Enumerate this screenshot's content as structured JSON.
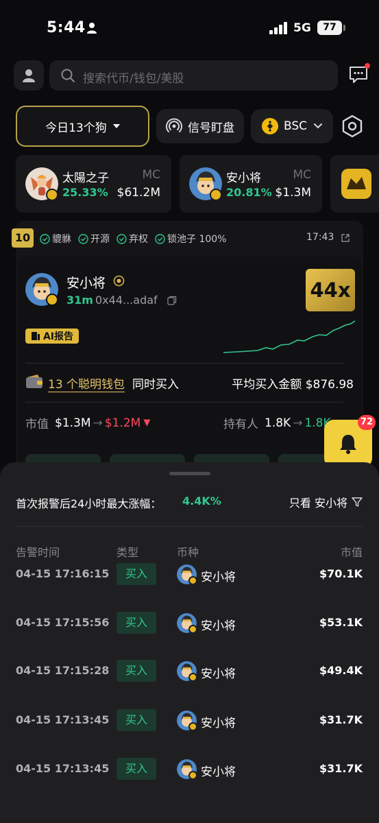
{
  "status": {
    "time": "5:44",
    "network": "5G",
    "battery": "77"
  },
  "search": {
    "placeholder": "搜索代币/钱包/美股"
  },
  "filters": {
    "dog_tab": "今日13个狗",
    "signal": "信号盯盘",
    "chain": "BSC"
  },
  "top_cards": [
    {
      "name": "太陽之子",
      "mc_label": "MC",
      "pct": "25.33%",
      "cap": "$61.2M"
    },
    {
      "name": "安小将",
      "mc_label": "MC",
      "pct": "20.81%",
      "cap": "$1.3M"
    }
  ],
  "signal": {
    "rank": "10",
    "checks": [
      "貔貅",
      "开源",
      "弃权",
      "锁池子 100%"
    ],
    "time": "17:43",
    "token_name": "安小将",
    "age": "31m",
    "address": "0x44...adaf",
    "multiplier": "44x",
    "ai_label": "AI报告",
    "wallet_count": "13 个聪明钱包",
    "wallet_tail": "同时买入",
    "avg_buy": "平均买入金额 $876.98",
    "mc_label": "市值",
    "mc_from": "$1.3M",
    "mc_to": "$1.2M",
    "holders_label": "持有人",
    "holders_from": "1.8K",
    "holders_to": "1.8K"
  },
  "bell": {
    "count": "72"
  },
  "sheet": {
    "title": "首次报警后24小时最大涨幅：",
    "max_gain": "4.4K%",
    "only_view": "只看 安小将",
    "headers": {
      "time": "告警时间",
      "type": "类型",
      "token": "币种",
      "cap": "市值"
    },
    "rows": [
      {
        "time": "04-15 17:16:15",
        "type": "买入",
        "token": "安小将",
        "cap": "$70.1K"
      },
      {
        "time": "04-15 17:15:56",
        "type": "买入",
        "token": "安小将",
        "cap": "$53.1K"
      },
      {
        "time": "04-15 17:15:28",
        "type": "买入",
        "token": "安小将",
        "cap": "$49.4K"
      },
      {
        "time": "04-15 17:13:45",
        "type": "买入",
        "token": "安小将",
        "cap": "$31.7K"
      },
      {
        "time": "04-15 17:13:45",
        "type": "买入",
        "token": "安小将",
        "cap": "$31.7K"
      }
    ]
  },
  "colors": {
    "accent_gold": "#d7b648",
    "green": "#2fc790",
    "red": "#ff4a5e",
    "bell": "#f2cf3d"
  },
  "icons": [
    "person-icon",
    "search-icon",
    "message-icon",
    "signal-radar-icon",
    "bnb-icon",
    "settings-icon",
    "check-circle-icon",
    "external-link-icon",
    "verified-icon",
    "copy-icon",
    "report-icon",
    "wallet-icon",
    "bell-icon",
    "filter-icon"
  ]
}
